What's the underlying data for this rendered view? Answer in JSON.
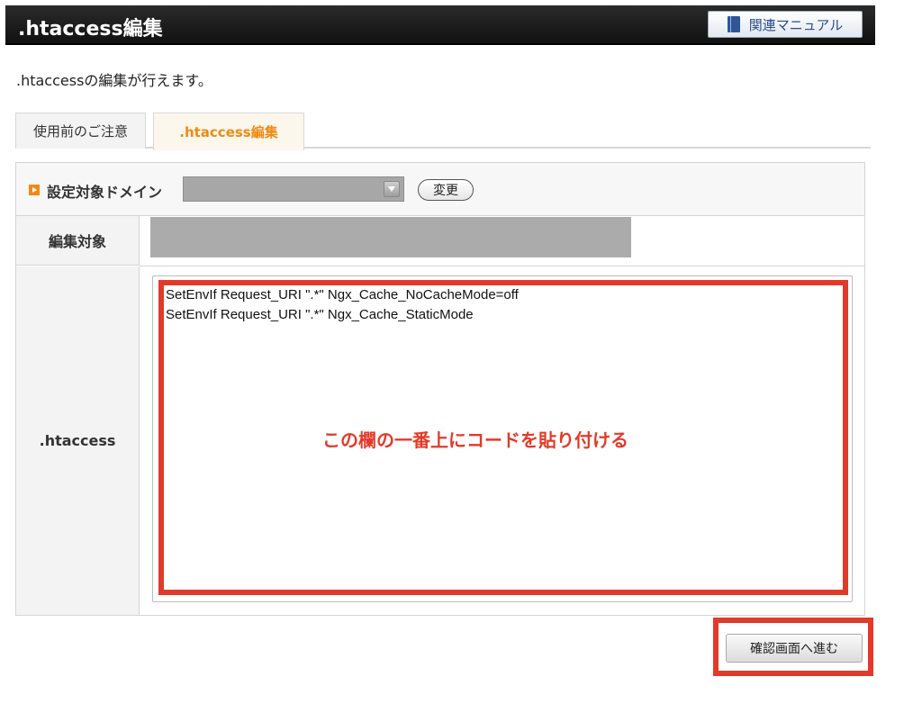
{
  "header": {
    "title": ".htaccess編集",
    "manual_label": "関連マニュアル"
  },
  "intro": ".htaccessの編集が行えます。",
  "tabs": [
    {
      "label": "使用前のご注意",
      "active": false
    },
    {
      "label": ".htaccess編集",
      "active": true
    }
  ],
  "form": {
    "domain_label": "設定対象ドメイン",
    "change_label": "変更",
    "target_label": "編集対象",
    "htaccess_label": ".htaccess",
    "htaccess_content": "SetEnvIf Request_URI \".*\" Ngx_Cache_NoCacheMode=off\nSetEnvIf Request_URI \".*\" Ngx_Cache_StaticMode",
    "annotation": "この欄の一番上にコードを貼り付ける"
  },
  "confirm_label": "確認画面へ進む",
  "colors": {
    "accent": "#ef8a14",
    "highlight": "#e23a2a",
    "header": "#1a1a1a"
  }
}
